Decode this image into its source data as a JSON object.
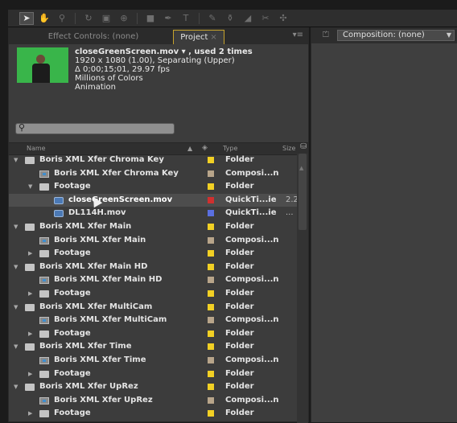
{
  "toolbar": {
    "tools": [
      {
        "name": "selection-tool-icon",
        "glyph": "➤",
        "active": true
      },
      {
        "name": "hand-tool-icon",
        "glyph": "✋",
        "active": false
      },
      {
        "name": "zoom-tool-icon",
        "glyph": "⚲",
        "active": false
      },
      {
        "name": "rotate-tool-icon",
        "glyph": "↻",
        "active": false
      },
      {
        "name": "camera-tool-icon",
        "glyph": "▣",
        "active": false
      },
      {
        "name": "pan-behind-tool-icon",
        "glyph": "⊕",
        "active": false
      },
      {
        "name": "rectangle-tool-icon",
        "glyph": "■",
        "active": false
      },
      {
        "name": "pen-tool-icon",
        "glyph": "✒",
        "active": false
      },
      {
        "name": "type-tool-icon",
        "glyph": "T",
        "active": false
      },
      {
        "name": "brush-tool-icon",
        "glyph": "✎",
        "active": false
      },
      {
        "name": "clone-stamp-tool-icon",
        "glyph": "⚱",
        "active": false
      },
      {
        "name": "eraser-tool-icon",
        "glyph": "◢",
        "active": false
      },
      {
        "name": "roto-brush-tool-icon",
        "glyph": "✂",
        "active": false
      },
      {
        "name": "puppet-tool-icon",
        "glyph": "✣",
        "active": false
      }
    ]
  },
  "left_panel": {
    "tabs": {
      "effect_controls": "Effect Controls: (none)",
      "project": "Project"
    },
    "info": {
      "filename": "closeGreenScreen.mov ▾ , used 2 times",
      "line2": "1920 x 1080 (1.00), Separating (Upper)",
      "line3": "Δ 0;00;15;01, 29.97 fps",
      "line4": "Millions of Colors",
      "line5": "Animation"
    },
    "search": {
      "placeholder": ""
    },
    "columns": {
      "name": "Name",
      "type": "Type",
      "size": "Size"
    },
    "rows": [
      {
        "depth": 0,
        "expand": "open",
        "icon": "folder",
        "name": "Boris XML Xfer Chroma Key",
        "label_color": "#f2d024",
        "type": "Folder",
        "size": ""
      },
      {
        "depth": 1,
        "expand": "none",
        "icon": "comp",
        "name": "Boris XML Xfer Chroma Key",
        "label_color": "#b8a58a",
        "type": "Composi...n",
        "size": ""
      },
      {
        "depth": 1,
        "expand": "open",
        "icon": "folder",
        "name": "Footage",
        "label_color": "#f2d024",
        "type": "Folder",
        "size": ""
      },
      {
        "depth": 2,
        "expand": "none",
        "icon": "qt",
        "name": "closeGreenScreen.mov",
        "label_color": "#d0302f",
        "type": "QuickTi...ie",
        "size": "2.2",
        "selected": true
      },
      {
        "depth": 2,
        "expand": "none",
        "icon": "qt",
        "name": "DL114H.mov",
        "label_color": "#5a6fe0",
        "type": "QuickTi...ie",
        "size": "..."
      },
      {
        "depth": 0,
        "expand": "open",
        "icon": "folder",
        "name": "Boris XML Xfer Main",
        "label_color": "#f2d024",
        "type": "Folder",
        "size": ""
      },
      {
        "depth": 1,
        "expand": "none",
        "icon": "comp",
        "name": "Boris XML Xfer Main",
        "label_color": "#b8a58a",
        "type": "Composi...n",
        "size": ""
      },
      {
        "depth": 1,
        "expand": "closed",
        "icon": "folder",
        "name": "Footage",
        "label_color": "#f2d024",
        "type": "Folder",
        "size": ""
      },
      {
        "depth": 0,
        "expand": "open",
        "icon": "folder",
        "name": "Boris XML Xfer Main HD",
        "label_color": "#f2d024",
        "type": "Folder",
        "size": ""
      },
      {
        "depth": 1,
        "expand": "none",
        "icon": "comp",
        "name": "Boris XML Xfer Main HD",
        "label_color": "#b8a58a",
        "type": "Composi...n",
        "size": ""
      },
      {
        "depth": 1,
        "expand": "closed",
        "icon": "folder",
        "name": "Footage",
        "label_color": "#f2d024",
        "type": "Folder",
        "size": ""
      },
      {
        "depth": 0,
        "expand": "open",
        "icon": "folder",
        "name": "Boris XML Xfer MultiCam",
        "label_color": "#f2d024",
        "type": "Folder",
        "size": ""
      },
      {
        "depth": 1,
        "expand": "none",
        "icon": "comp",
        "name": "Boris XML Xfer MultiCam",
        "label_color": "#b8a58a",
        "type": "Composi...n",
        "size": ""
      },
      {
        "depth": 1,
        "expand": "closed",
        "icon": "folder",
        "name": "Footage",
        "label_color": "#f2d024",
        "type": "Folder",
        "size": ""
      },
      {
        "depth": 0,
        "expand": "open",
        "icon": "folder",
        "name": "Boris XML Xfer Time",
        "label_color": "#f2d024",
        "type": "Folder",
        "size": ""
      },
      {
        "depth": 1,
        "expand": "none",
        "icon": "comp",
        "name": "Boris XML Xfer Time",
        "label_color": "#b8a58a",
        "type": "Composi...n",
        "size": ""
      },
      {
        "depth": 1,
        "expand": "closed",
        "icon": "folder",
        "name": "Footage",
        "label_color": "#f2d024",
        "type": "Folder",
        "size": ""
      },
      {
        "depth": 0,
        "expand": "open",
        "icon": "folder",
        "name": "Boris XML Xfer UpRez",
        "label_color": "#f2d024",
        "type": "Folder",
        "size": ""
      },
      {
        "depth": 1,
        "expand": "none",
        "icon": "comp",
        "name": "Boris XML Xfer UpRez",
        "label_color": "#b8a58a",
        "type": "Composi...n",
        "size": ""
      },
      {
        "depth": 1,
        "expand": "closed",
        "icon": "folder",
        "name": "Footage",
        "label_color": "#f2d024",
        "type": "Folder",
        "size": ""
      }
    ]
  },
  "right_panel": {
    "composition_dropdown": "Composition: (none)"
  },
  "colors": {
    "accent_tab_border": "#c7a32c",
    "panel_bg": "#3c3c3c",
    "selection_bg": "#4d4d4d"
  }
}
